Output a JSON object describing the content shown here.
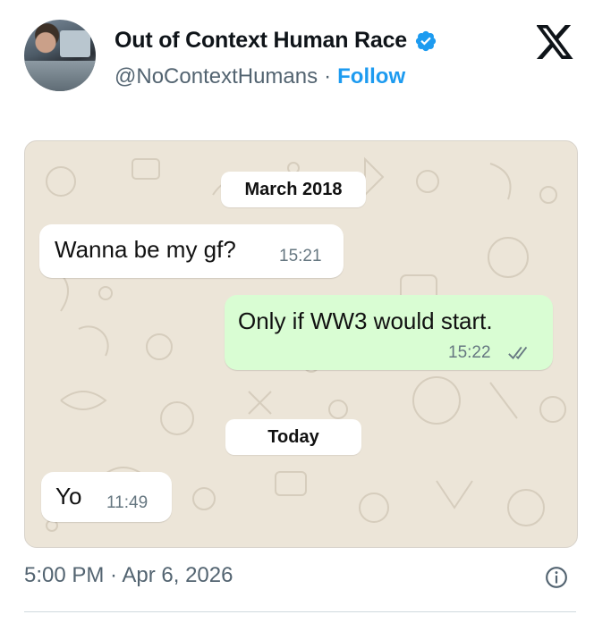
{
  "tweet": {
    "display_name": "Out of Context Human Race",
    "handle": "@NoContextHumans",
    "separator": "·",
    "follow_label": "Follow",
    "timestamp": "5:00 PM · Apr 6, 2026",
    "verified": true,
    "colors": {
      "accent": "#1d9bf0",
      "secondary_text": "#536471"
    }
  },
  "chat": {
    "date_pills": [
      {
        "label": "March 2018"
      },
      {
        "label": "Today"
      }
    ],
    "messages": [
      {
        "direction": "incoming",
        "text": "Wanna be my gf?",
        "time": "15:21"
      },
      {
        "direction": "outgoing",
        "text": "Only if WW3 would start.",
        "time": "15:22",
        "status": "read"
      },
      {
        "direction": "incoming",
        "text": "Yo",
        "time": "11:49"
      }
    ],
    "colors": {
      "background": "#ece5d8",
      "incoming_bubble": "#ffffff",
      "outgoing_bubble": "#d9fdd3",
      "read_ticks": "#667781"
    }
  },
  "icons": {
    "brand": "x-logo-icon",
    "verified": "verified-badge-icon",
    "info": "info-icon"
  }
}
